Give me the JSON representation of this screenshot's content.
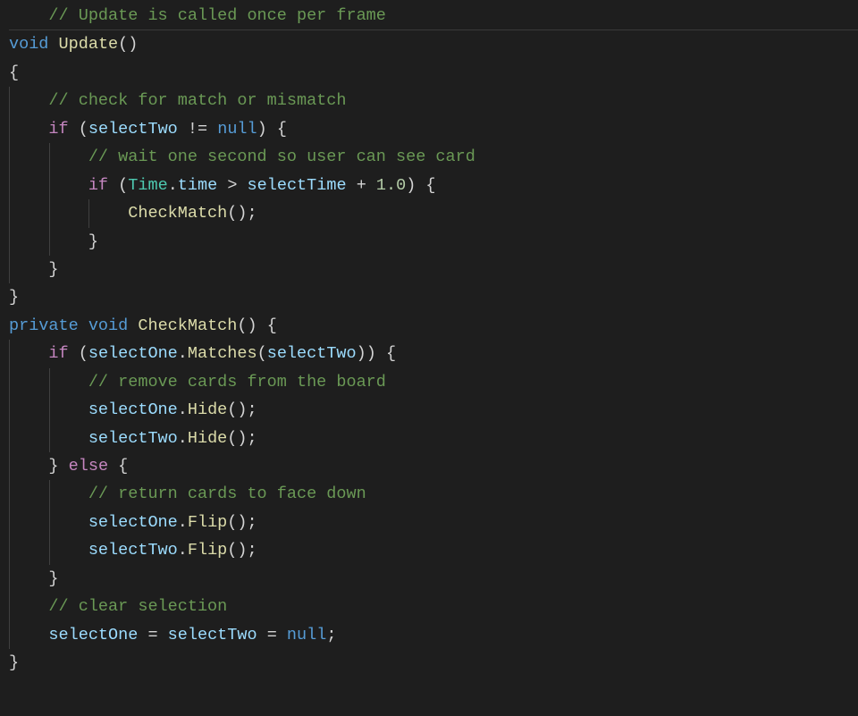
{
  "code": {
    "lines": [
      {
        "indent": 1,
        "tokens": [
          {
            "cls": "tk-comment",
            "t": "// Update is called once per frame"
          }
        ],
        "guides": [],
        "top": true
      },
      {
        "indent": 0,
        "tokens": [
          {
            "cls": "tk-keyword",
            "t": "void"
          },
          {
            "cls": "",
            "t": " "
          },
          {
            "cls": "tk-func",
            "t": "Update"
          },
          {
            "cls": "tk-punc",
            "t": "()"
          }
        ],
        "guides": []
      },
      {
        "indent": 0,
        "tokens": [
          {
            "cls": "tk-punc",
            "t": "{"
          }
        ],
        "guides": []
      },
      {
        "indent": 1,
        "tokens": [
          {
            "cls": "tk-comment",
            "t": "// check for match or mismatch"
          }
        ],
        "guides": [
          0
        ]
      },
      {
        "indent": 1,
        "tokens": [
          {
            "cls": "tk-control",
            "t": "if"
          },
          {
            "cls": "",
            "t": " "
          },
          {
            "cls": "tk-punc",
            "t": "("
          },
          {
            "cls": "tk-var",
            "t": "selectTwo"
          },
          {
            "cls": "",
            "t": " "
          },
          {
            "cls": "tk-op",
            "t": "!="
          },
          {
            "cls": "",
            "t": " "
          },
          {
            "cls": "tk-keyword",
            "t": "null"
          },
          {
            "cls": "tk-punc",
            "t": ") {"
          }
        ],
        "guides": [
          0
        ]
      },
      {
        "indent": 2,
        "tokens": [
          {
            "cls": "tk-comment",
            "t": "// wait one second so user can see card"
          }
        ],
        "guides": [
          0,
          1
        ]
      },
      {
        "indent": 2,
        "tokens": [
          {
            "cls": "tk-control",
            "t": "if"
          },
          {
            "cls": "",
            "t": " "
          },
          {
            "cls": "tk-punc",
            "t": "("
          },
          {
            "cls": "tk-type",
            "t": "Time"
          },
          {
            "cls": "tk-punc",
            "t": "."
          },
          {
            "cls": "tk-var",
            "t": "time"
          },
          {
            "cls": "",
            "t": " "
          },
          {
            "cls": "tk-op",
            "t": ">"
          },
          {
            "cls": "",
            "t": " "
          },
          {
            "cls": "tk-var",
            "t": "selectTime"
          },
          {
            "cls": "",
            "t": " "
          },
          {
            "cls": "tk-op",
            "t": "+"
          },
          {
            "cls": "",
            "t": " "
          },
          {
            "cls": "tk-num",
            "t": "1.0"
          },
          {
            "cls": "tk-punc",
            "t": ") {"
          }
        ],
        "guides": [
          0,
          1
        ]
      },
      {
        "indent": 3,
        "tokens": [
          {
            "cls": "tk-func",
            "t": "CheckMatch"
          },
          {
            "cls": "tk-punc",
            "t": "();"
          }
        ],
        "guides": [
          0,
          1,
          2
        ]
      },
      {
        "indent": 2,
        "tokens": [
          {
            "cls": "tk-punc",
            "t": "}"
          }
        ],
        "guides": [
          0,
          1
        ]
      },
      {
        "indent": 1,
        "tokens": [
          {
            "cls": "tk-punc",
            "t": "}"
          }
        ],
        "guides": [
          0
        ]
      },
      {
        "indent": 0,
        "tokens": [
          {
            "cls": "tk-punc",
            "t": "}"
          }
        ],
        "guides": []
      },
      {
        "indent": 0,
        "tokens": [
          {
            "cls": "",
            "t": ""
          }
        ],
        "guides": []
      },
      {
        "indent": 0,
        "tokens": [
          {
            "cls": "tk-keyword",
            "t": "private"
          },
          {
            "cls": "",
            "t": " "
          },
          {
            "cls": "tk-keyword",
            "t": "void"
          },
          {
            "cls": "",
            "t": " "
          },
          {
            "cls": "tk-func",
            "t": "CheckMatch"
          },
          {
            "cls": "tk-punc",
            "t": "() {"
          }
        ],
        "guides": []
      },
      {
        "indent": 1,
        "tokens": [
          {
            "cls": "tk-control",
            "t": "if"
          },
          {
            "cls": "",
            "t": " "
          },
          {
            "cls": "tk-punc",
            "t": "("
          },
          {
            "cls": "tk-var",
            "t": "selectOne"
          },
          {
            "cls": "tk-punc",
            "t": "."
          },
          {
            "cls": "tk-func",
            "t": "Matches"
          },
          {
            "cls": "tk-punc",
            "t": "("
          },
          {
            "cls": "tk-var",
            "t": "selectTwo"
          },
          {
            "cls": "tk-punc",
            "t": ")) {"
          }
        ],
        "guides": [
          0
        ]
      },
      {
        "indent": 2,
        "tokens": [
          {
            "cls": "tk-comment",
            "t": "// remove cards from the board"
          }
        ],
        "guides": [
          0,
          1
        ]
      },
      {
        "indent": 2,
        "tokens": [
          {
            "cls": "tk-var",
            "t": "selectOne"
          },
          {
            "cls": "tk-punc",
            "t": "."
          },
          {
            "cls": "tk-func",
            "t": "Hide"
          },
          {
            "cls": "tk-punc",
            "t": "();"
          }
        ],
        "guides": [
          0,
          1
        ]
      },
      {
        "indent": 2,
        "tokens": [
          {
            "cls": "tk-var",
            "t": "selectTwo"
          },
          {
            "cls": "tk-punc",
            "t": "."
          },
          {
            "cls": "tk-func",
            "t": "Hide"
          },
          {
            "cls": "tk-punc",
            "t": "();"
          }
        ],
        "guides": [
          0,
          1
        ]
      },
      {
        "indent": 1,
        "tokens": [
          {
            "cls": "tk-punc",
            "t": "} "
          },
          {
            "cls": "tk-control",
            "t": "else"
          },
          {
            "cls": "tk-punc",
            "t": " {"
          }
        ],
        "guides": [
          0
        ]
      },
      {
        "indent": 2,
        "tokens": [
          {
            "cls": "tk-comment",
            "t": "// return cards to face down"
          }
        ],
        "guides": [
          0,
          1
        ]
      },
      {
        "indent": 2,
        "tokens": [
          {
            "cls": "tk-var",
            "t": "selectOne"
          },
          {
            "cls": "tk-punc",
            "t": "."
          },
          {
            "cls": "tk-func",
            "t": "Flip"
          },
          {
            "cls": "tk-punc",
            "t": "();"
          }
        ],
        "guides": [
          0,
          1
        ]
      },
      {
        "indent": 2,
        "tokens": [
          {
            "cls": "tk-var",
            "t": "selectTwo"
          },
          {
            "cls": "tk-punc",
            "t": "."
          },
          {
            "cls": "tk-func",
            "t": "Flip"
          },
          {
            "cls": "tk-punc",
            "t": "();"
          }
        ],
        "guides": [
          0,
          1
        ]
      },
      {
        "indent": 1,
        "tokens": [
          {
            "cls": "tk-punc",
            "t": "}"
          }
        ],
        "guides": [
          0
        ]
      },
      {
        "indent": 1,
        "tokens": [
          {
            "cls": "tk-comment",
            "t": "// clear selection"
          }
        ],
        "guides": [
          0
        ]
      },
      {
        "indent": 1,
        "tokens": [
          {
            "cls": "tk-var",
            "t": "selectOne"
          },
          {
            "cls": "",
            "t": " "
          },
          {
            "cls": "tk-op",
            "t": "="
          },
          {
            "cls": "",
            "t": " "
          },
          {
            "cls": "tk-var",
            "t": "selectTwo"
          },
          {
            "cls": "",
            "t": " "
          },
          {
            "cls": "tk-op",
            "t": "="
          },
          {
            "cls": "",
            "t": " "
          },
          {
            "cls": "tk-keyword",
            "t": "null"
          },
          {
            "cls": "tk-punc",
            "t": ";"
          }
        ],
        "guides": [
          0
        ]
      },
      {
        "indent": 0,
        "tokens": [
          {
            "cls": "tk-punc",
            "t": "}"
          }
        ],
        "guides": []
      }
    ],
    "indent_unit": "    "
  }
}
